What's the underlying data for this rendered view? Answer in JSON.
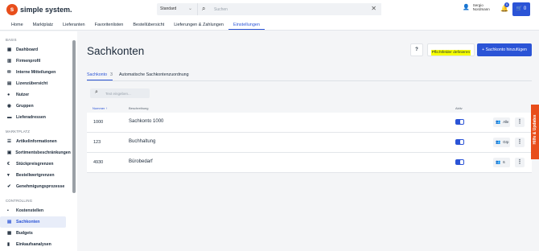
{
  "brand": {
    "logo_text": "simple system.",
    "logo_mark": "s",
    "accent": "#2b54d6",
    "brand_orange": "#e84e1b"
  },
  "header": {
    "shop_select": "Standard",
    "search_placeholder": "Suchen",
    "user_first": "Sergio",
    "user_last": "Nordmann",
    "notification_count": "0",
    "cart_count": "0"
  },
  "nav": [
    "Home",
    "Marktplatz",
    "Lieferanten",
    "Favoritenlisten",
    "Bestellübersicht",
    "Lieferungen & Zahlungen",
    "Einstellungen"
  ],
  "sidebar": {
    "sections": [
      {
        "title": "BASIS",
        "items": [
          {
            "label": "Dashboard",
            "icon": "grid-icon"
          },
          {
            "label": "Firmenprofil",
            "icon": "building-icon"
          },
          {
            "label": "Interne Mitteilungen",
            "icon": "chat-icon"
          },
          {
            "label": "Lizenzübersicht",
            "icon": "document-icon"
          },
          {
            "label": "Nutzer",
            "icon": "users-icon"
          },
          {
            "label": "Gruppen",
            "icon": "group-icon"
          },
          {
            "label": "Lieferadressen",
            "icon": "truck-icon"
          }
        ]
      },
      {
        "title": "MARKTPLATZ",
        "items": [
          {
            "label": "Artikelinformationen",
            "icon": "list-icon"
          },
          {
            "label": "Sortimentsbeschränkungen",
            "icon": "lock-icon"
          },
          {
            "label": "Stückpreisgrenzen",
            "icon": "euro-icon"
          },
          {
            "label": "Bestellwertgrenzen",
            "icon": "cart-icon"
          },
          {
            "label": "Genehmigungsprozesse",
            "icon": "check-icon"
          }
        ]
      },
      {
        "title": "CONTROLLING",
        "items": [
          {
            "label": "Kostenstellen",
            "icon": "sitemap-icon"
          },
          {
            "label": "Sachkonten",
            "icon": "ledger-icon",
            "active": true
          },
          {
            "label": "Budgets",
            "icon": "wallet-icon"
          },
          {
            "label": "Einkaufsanalysen",
            "icon": "chart-icon"
          }
        ]
      }
    ]
  },
  "main": {
    "title": "Sachkonten",
    "help_label": "?",
    "required_fields_label": "Pflichtfelder definieren",
    "add_label": "+  Sachkonto hinzufügen",
    "tabs": [
      {
        "label": "Sachkonto",
        "count": "3"
      },
      {
        "label": "Automatische Sachkontenzuordnung",
        "count": ""
      }
    ],
    "filter_placeholder": "Text eingeben...",
    "columns": {
      "number": "Nummer",
      "sort": "↑",
      "description": "Beschreibung",
      "active": "Aktiv"
    },
    "rows": [
      {
        "number": "1000",
        "description": "Sachkonto 1000",
        "active": true,
        "users": "Alle"
      },
      {
        "number": "123",
        "description": "Buchhaltung",
        "active": true,
        "users": "Grp"
      },
      {
        "number": "4930",
        "description": "Bürobedarf",
        "active": true,
        "users": "6"
      }
    ],
    "more_label": "⋮"
  },
  "help_tab": "Hilfe & Updates"
}
